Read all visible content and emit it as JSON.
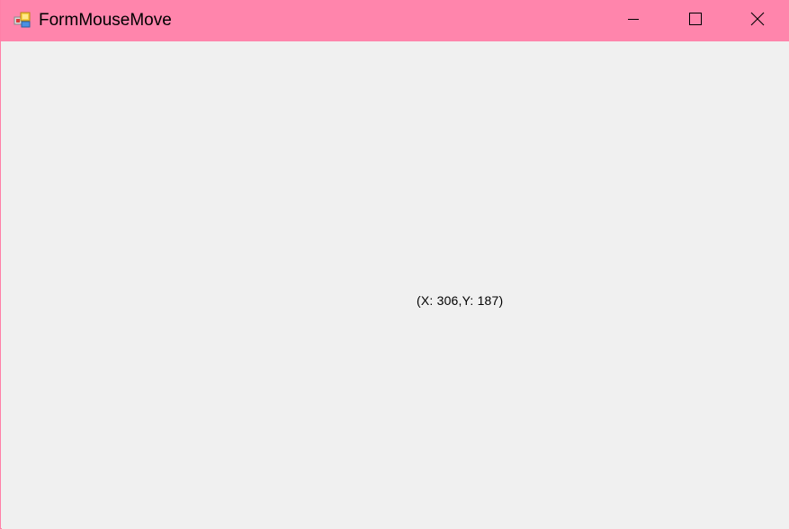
{
  "window": {
    "title": "FormMouseMove",
    "titlebar_color": "#ff85ac",
    "client_background": "#f0f0f0",
    "icon": "windows-form-app-icon"
  },
  "caption_buttons": {
    "minimize_icon": "minimize-icon",
    "maximize_icon": "maximize-icon",
    "close_icon": "close-icon"
  },
  "client": {
    "coordinate_label": "(X: 306,Y: 187)"
  }
}
